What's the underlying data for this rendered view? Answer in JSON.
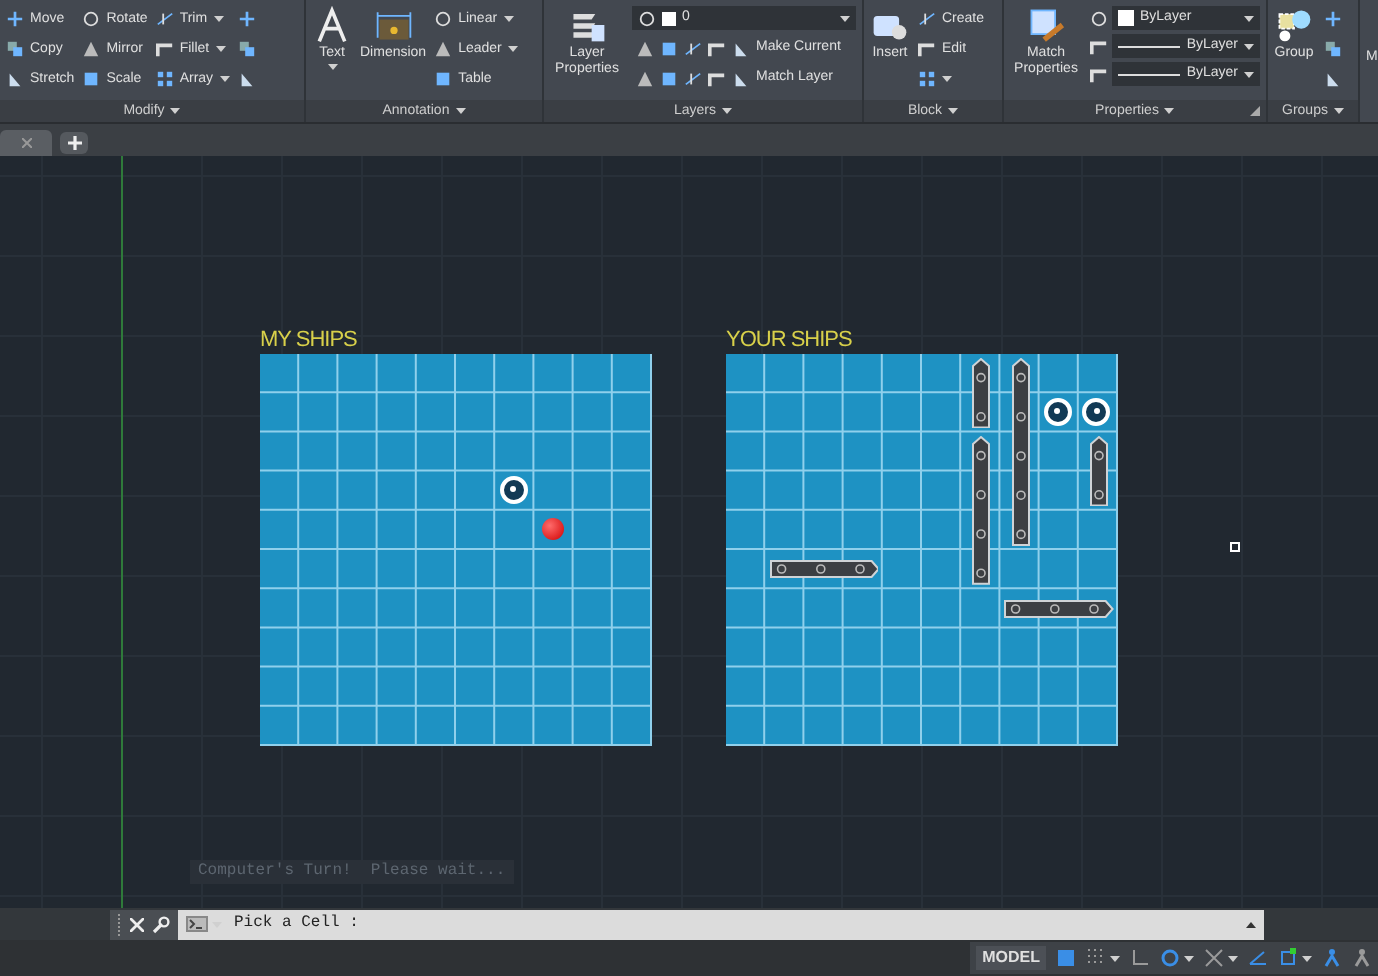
{
  "ribbon": {
    "panels": [
      {
        "title": "Modify",
        "columns": [
          {
            "kind": "small",
            "items": [
              {
                "label": "Move",
                "caret": false
              },
              {
                "label": "Copy",
                "caret": false
              },
              {
                "label": "Stretch",
                "caret": false
              }
            ]
          },
          {
            "kind": "small",
            "items": [
              {
                "label": "Rotate",
                "caret": false
              },
              {
                "label": "Mirror",
                "caret": false
              },
              {
                "label": "Scale",
                "caret": false
              }
            ]
          },
          {
            "kind": "small",
            "items": [
              {
                "label": "Trim",
                "caret": true
              },
              {
                "label": "Fillet",
                "caret": true
              },
              {
                "label": "Array",
                "caret": true
              }
            ]
          },
          {
            "kind": "icons"
          }
        ]
      },
      {
        "title": "Annotation",
        "columns": [
          {
            "kind": "large",
            "label": "Text",
            "caret": true
          },
          {
            "kind": "large",
            "label": "Dimension",
            "caret": false
          },
          {
            "kind": "small",
            "items": [
              {
                "label": "Linear",
                "caret": true
              },
              {
                "label": "Leader",
                "caret": true
              },
              {
                "label": "Table",
                "caret": false
              }
            ]
          }
        ]
      },
      {
        "title": "Layers",
        "columns": [
          {
            "kind": "large",
            "label": "Layer Properties",
            "caret": false
          },
          {
            "kind": "layers",
            "value": "0",
            "items": [
              {
                "label": "Make Current"
              },
              {
                "label": "Match Layer"
              }
            ]
          }
        ]
      },
      {
        "title": "Block",
        "columns": [
          {
            "kind": "large",
            "label": "Insert",
            "caret": false
          },
          {
            "kind": "small",
            "items": [
              {
                "label": "Create",
                "caret": false
              },
              {
                "label": "Edit",
                "caret": false
              },
              {
                "caret": true
              }
            ]
          }
        ]
      },
      {
        "title": "Properties",
        "launcher": true,
        "columns": [
          {
            "kind": "large",
            "label": "Match Properties",
            "caret": false
          },
          {
            "kind": "dropdowns",
            "items": [
              {
                "value": "ByLayer",
                "swatch": true
              },
              {
                "value": "ByLayer",
                "swatch": false
              },
              {
                "value": "ByLayer",
                "swatch": false
              }
            ]
          }
        ]
      },
      {
        "title": "Groups",
        "launcher": false,
        "columns": [
          {
            "kind": "large",
            "label": "Group",
            "caret": false
          },
          {
            "kind": "icons"
          }
        ]
      }
    ],
    "cut_panel": {
      "label": "M"
    }
  },
  "file_tabs": {
    "new_tab": true
  },
  "boards": [
    {
      "title": "MY SHIPS",
      "rows": [
        [
          {
            "kind": "sea"
          },
          {
            "kind": "sea"
          },
          {
            "kind": "sea"
          },
          {
            "kind": "sea"
          },
          {
            "kind": "sea"
          },
          {
            "kind": "sea"
          },
          {
            "kind": "sea"
          },
          {
            "kind": "sea"
          },
          {
            "kind": "sea"
          },
          {
            "kind": "sea"
          }
        ],
        [
          {
            "kind": "sea"
          },
          {
            "kind": "sea"
          },
          {
            "kind": "sea"
          },
          {
            "kind": "sea"
          },
          {
            "kind": "sea"
          },
          {
            "kind": "sea"
          },
          {
            "kind": "sea"
          },
          {
            "kind": "sea"
          },
          {
            "kind": "sea"
          },
          {
            "kind": "sea"
          }
        ],
        [
          {
            "kind": "sea"
          },
          {
            "kind": "sea"
          },
          {
            "kind": "sea"
          },
          {
            "kind": "sea"
          },
          {
            "kind": "sea"
          },
          {
            "kind": "sea"
          },
          {
            "kind": "sea"
          },
          {
            "kind": "sea"
          },
          {
            "kind": "sea"
          },
          {
            "kind": "sea"
          }
        ],
        [
          {
            "kind": "sea"
          },
          {
            "kind": "sea"
          },
          {
            "kind": "sea"
          },
          {
            "kind": "sea"
          },
          {
            "kind": "sea"
          },
          {
            "kind": "sea"
          },
          {
            "kind": "miss"
          },
          {
            "kind": "sea"
          },
          {
            "kind": "sea"
          },
          {
            "kind": "sea"
          }
        ],
        [
          {
            "kind": "sea"
          },
          {
            "kind": "sea"
          },
          {
            "kind": "sea"
          },
          {
            "kind": "sea"
          },
          {
            "kind": "sea"
          },
          {
            "kind": "sea"
          },
          {
            "kind": "sea"
          },
          {
            "kind": "hit"
          },
          {
            "kind": "sea"
          },
          {
            "kind": "sea"
          }
        ],
        [
          {
            "kind": "sea"
          },
          {
            "kind": "sea"
          },
          {
            "kind": "sea"
          },
          {
            "kind": "sea"
          },
          {
            "kind": "sea"
          },
          {
            "kind": "sea"
          },
          {
            "kind": "sea"
          },
          {
            "kind": "sea"
          },
          {
            "kind": "sea"
          },
          {
            "kind": "sea"
          }
        ],
        [
          {
            "kind": "sea"
          },
          {
            "kind": "sea"
          },
          {
            "kind": "sea"
          },
          {
            "kind": "sea"
          },
          {
            "kind": "sea"
          },
          {
            "kind": "sea"
          },
          {
            "kind": "sea"
          },
          {
            "kind": "sea"
          },
          {
            "kind": "sea"
          },
          {
            "kind": "sea"
          }
        ],
        [
          {
            "kind": "sea"
          },
          {
            "kind": "sea"
          },
          {
            "kind": "sea"
          },
          {
            "kind": "sea"
          },
          {
            "kind": "sea"
          },
          {
            "kind": "sea"
          },
          {
            "kind": "sea"
          },
          {
            "kind": "sea"
          },
          {
            "kind": "sea"
          },
          {
            "kind": "sea"
          }
        ],
        [
          {
            "kind": "sea"
          },
          {
            "kind": "sea"
          },
          {
            "kind": "sea"
          },
          {
            "kind": "sea"
          },
          {
            "kind": "sea"
          },
          {
            "kind": "sea"
          },
          {
            "kind": "sea"
          },
          {
            "kind": "sea"
          },
          {
            "kind": "sea"
          },
          {
            "kind": "sea"
          }
        ],
        [
          {
            "kind": "sea"
          },
          {
            "kind": "sea"
          },
          {
            "kind": "sea"
          },
          {
            "kind": "sea"
          },
          {
            "kind": "sea"
          },
          {
            "kind": "sea"
          },
          {
            "kind": "sea"
          },
          {
            "kind": "sea"
          },
          {
            "kind": "sea"
          },
          {
            "kind": "sea"
          }
        ]
      ]
    },
    {
      "title": "YOUR SHIPS",
      "rows": [
        [
          {
            "kind": "sea"
          },
          {
            "kind": "sea"
          },
          {
            "kind": "sea"
          },
          {
            "kind": "sea"
          },
          {
            "kind": "sea"
          },
          {
            "kind": "sea"
          },
          {
            "kind": "bow_up"
          },
          {
            "kind": "bow_up"
          },
          {
            "kind": "sea"
          },
          {
            "kind": "sea"
          }
        ],
        [
          {
            "kind": "sea"
          },
          {
            "kind": "sea"
          },
          {
            "kind": "sea"
          },
          {
            "kind": "sea"
          },
          {
            "kind": "sea"
          },
          {
            "kind": "sea"
          },
          {
            "kind": "stern_down"
          },
          {
            "kind": "hull_v"
          },
          {
            "kind": "miss"
          },
          {
            "kind": "miss"
          }
        ],
        [
          {
            "kind": "sea"
          },
          {
            "kind": "sea"
          },
          {
            "kind": "sea"
          },
          {
            "kind": "sea"
          },
          {
            "kind": "sea"
          },
          {
            "kind": "sea"
          },
          {
            "kind": "bow_up"
          },
          {
            "kind": "hull_v"
          },
          {
            "kind": "sea"
          },
          {
            "kind": "bow_up"
          }
        ],
        [
          {
            "kind": "sea"
          },
          {
            "kind": "sea"
          },
          {
            "kind": "sea"
          },
          {
            "kind": "sea"
          },
          {
            "kind": "sea"
          },
          {
            "kind": "sea"
          },
          {
            "kind": "hull_v"
          },
          {
            "kind": "hull_v"
          },
          {
            "kind": "sea"
          },
          {
            "kind": "stern_down"
          }
        ],
        [
          {
            "kind": "sea"
          },
          {
            "kind": "sea"
          },
          {
            "kind": "sea"
          },
          {
            "kind": "sea"
          },
          {
            "kind": "sea"
          },
          {
            "kind": "sea"
          },
          {
            "kind": "hull_v"
          },
          {
            "kind": "stern_down"
          },
          {
            "kind": "sea"
          },
          {
            "kind": "sea"
          }
        ],
        [
          {
            "kind": "sea"
          },
          {
            "kind": "stern_left"
          },
          {
            "kind": "hull_h"
          },
          {
            "kind": "bow_right"
          },
          {
            "kind": "sea"
          },
          {
            "kind": "sea"
          },
          {
            "kind": "stern_down"
          },
          {
            "kind": "sea"
          },
          {
            "kind": "sea"
          },
          {
            "kind": "sea"
          }
        ],
        [
          {
            "kind": "sea"
          },
          {
            "kind": "sea"
          },
          {
            "kind": "sea"
          },
          {
            "kind": "sea"
          },
          {
            "kind": "sea"
          },
          {
            "kind": "sea"
          },
          {
            "kind": "sea"
          },
          {
            "kind": "stern_left"
          },
          {
            "kind": "hull_h"
          },
          {
            "kind": "bow_right"
          }
        ],
        [
          {
            "kind": "sea"
          },
          {
            "kind": "sea"
          },
          {
            "kind": "sea"
          },
          {
            "kind": "sea"
          },
          {
            "kind": "sea"
          },
          {
            "kind": "sea"
          },
          {
            "kind": "sea"
          },
          {
            "kind": "sea"
          },
          {
            "kind": "sea"
          },
          {
            "kind": "sea"
          }
        ],
        [
          {
            "kind": "sea"
          },
          {
            "kind": "sea"
          },
          {
            "kind": "sea"
          },
          {
            "kind": "sea"
          },
          {
            "kind": "sea"
          },
          {
            "kind": "sea"
          },
          {
            "kind": "sea"
          },
          {
            "kind": "sea"
          },
          {
            "kind": "sea"
          },
          {
            "kind": "sea"
          }
        ],
        [
          {
            "kind": "sea"
          },
          {
            "kind": "sea"
          },
          {
            "kind": "sea"
          },
          {
            "kind": "sea"
          },
          {
            "kind": "sea"
          },
          {
            "kind": "sea"
          },
          {
            "kind": "sea"
          },
          {
            "kind": "sea"
          },
          {
            "kind": "sea"
          },
          {
            "kind": "sea"
          }
        ]
      ]
    }
  ],
  "command_line": {
    "history": [
      "Computer's Turn!  Please wait..."
    ],
    "prompt": "Pick a Cell :"
  },
  "status_bar": {
    "model": "MODEL",
    "toggles": [
      {
        "on": true
      },
      {
        "on": false
      },
      {
        "on": false
      },
      {
        "on": true
      },
      {
        "on": false
      },
      {
        "on": true
      },
      {
        "on": true
      },
      {
        "on": true
      },
      {
        "on": false
      }
    ]
  }
}
